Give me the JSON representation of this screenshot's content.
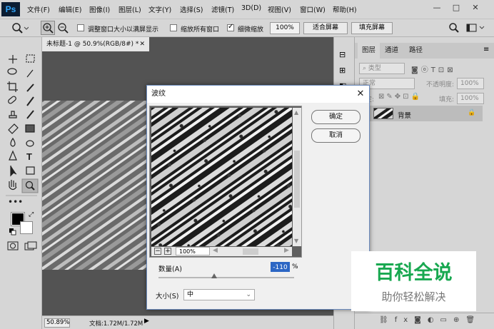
{
  "menubar": {
    "logo": "Ps",
    "items": [
      "文件(F)",
      "编辑(E)",
      "图像(I)",
      "图层(L)",
      "文字(Y)",
      "选择(S)",
      "滤镜(T)",
      "3D(D)",
      "视图(V)",
      "窗口(W)",
      "帮助(H)"
    ],
    "window_buttons": [
      "—",
      "□",
      "✕"
    ]
  },
  "optionsbar": {
    "resize_windows_label": "调整窗口大小以满屏显示",
    "zoom_all_label": "缩放所有窗口",
    "scrubby_zoom_label": "细微缩放",
    "zoom_value": "100%",
    "fit_screen_label": "适合屏幕",
    "fill_screen_label": "填充屏幕"
  },
  "document": {
    "tab_title": "未标题-1 @ 50.9%(RGB/8#) *",
    "status_zoom": "50.89%",
    "status_doc": "文档:1.72M/1.72M"
  },
  "layers_panel": {
    "tabs": [
      "图层",
      "通道",
      "路径"
    ],
    "filter_placeholder": "类型",
    "blend_mode": "正常",
    "opacity_label": "不透明度:",
    "opacity_value": "100%",
    "lock_label": "锁定:",
    "fill_label": "填充:",
    "fill_value": "100%",
    "layer_name": "背景"
  },
  "dialog": {
    "title": "波纹",
    "ok_label": "确定",
    "cancel_label": "取消",
    "preview_zoom": "100%",
    "amount_label": "数量(A)",
    "amount_value": "-110",
    "amount_unit": "%",
    "amount_fraction": 0.41,
    "size_label": "大小(S)",
    "size_value": "中"
  },
  "watermark": {
    "title": "百科全说",
    "subtitle": "助你轻松解决"
  },
  "colors": {
    "ui_gray": "#d6d6d6",
    "workspace": "#535353",
    "watermark_green": "#18a850",
    "selection_blue": "#2c66c4"
  }
}
